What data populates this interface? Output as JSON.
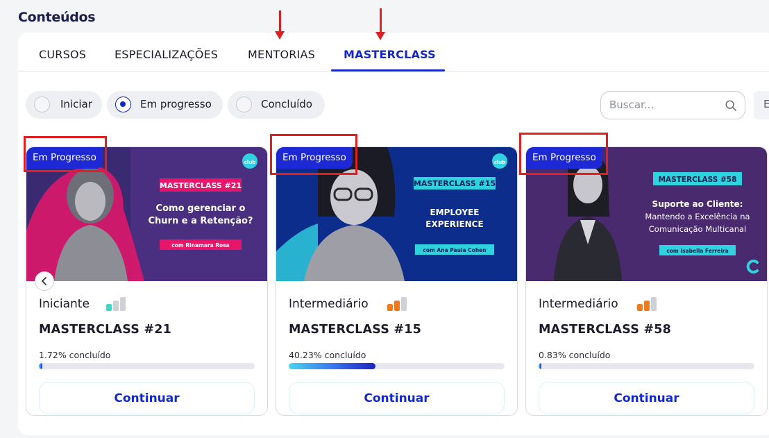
{
  "header": {
    "title": "Conteúdos"
  },
  "tabs": [
    {
      "label": "CURSOS",
      "active": false
    },
    {
      "label": "ESPECIALIZAÇÕES",
      "active": false
    },
    {
      "label": "MENTORIAS",
      "active": false
    },
    {
      "label": "MASTERCLASS",
      "active": true
    }
  ],
  "filters": [
    {
      "label": "Iniciar",
      "checked": false
    },
    {
      "label": "Em progresso",
      "checked": true
    },
    {
      "label": "Concluído",
      "checked": false
    }
  ],
  "search": {
    "placeholder": "Buscar...",
    "icon": "search-icon"
  },
  "edge_button": {
    "label": "E"
  },
  "carousel": {
    "prev_icon": "chevron-left-icon"
  },
  "cards": [
    {
      "badge": "Em Progresso",
      "level": "Iniciante",
      "level_icon": "level-bars-icon",
      "level_bars_filled": 1,
      "title": "MASTERCLASS #21",
      "progress_text": "1.72% concluído",
      "progress": 1.72,
      "button": "Continuar",
      "thumb": {
        "tag": "MASTERCLASS #21",
        "headline": [
          "Como gerenciar o",
          "Churn e a Retenção?"
        ],
        "presenter": "com Rinamara Rosa",
        "logo_text": "club",
        "bg": "#3b2a73",
        "tag_bg": "#e7166b",
        "tag_fg": "#ffffff"
      }
    },
    {
      "badge": "Em Progresso",
      "level": "Intermediário",
      "level_icon": "level-bars-icon",
      "level_bars_filled": 2,
      "title": "MASTERCLASS #15",
      "progress_text": "40.23% concluído",
      "progress": 40.23,
      "button": "Continuar",
      "thumb": {
        "tag": "MASTERCLASS #15",
        "headline": [
          "EMPLOYEE",
          "EXPERIENCE"
        ],
        "presenter": "com Ana Paula Cohen",
        "logo_text": "club",
        "bg": "#0d2d8c",
        "tag_bg": "#2fd3e0",
        "tag_fg": "#0d1f5c"
      }
    },
    {
      "badge": "Em Progresso",
      "level": "Intermediário",
      "level_icon": "level-bars-icon",
      "level_bars_filled": 2,
      "title": "MASTERCLASS #58",
      "progress_text": "0.83% concluído",
      "progress": 0.83,
      "button": "Continuar",
      "thumb": {
        "tag": "MASTERCLASS #58",
        "headline": [
          "Suporte ao Cliente:",
          "Mantendo a Excelência na",
          "Comunicação Multicanal"
        ],
        "presenter": "com Isabella Ferreira",
        "logo_text": "",
        "bg": "#4a2a6e",
        "tag_bg": "#2fd3e0",
        "tag_fg": "#1a1d4e"
      }
    }
  ],
  "colors": {
    "accent": "#1428c8",
    "badge": "#1e29d6",
    "annotation": "#e02020",
    "level_teal": "#3dd6c8",
    "level_orange": "#f07a1a",
    "level_empty": "#cfd1d8"
  }
}
